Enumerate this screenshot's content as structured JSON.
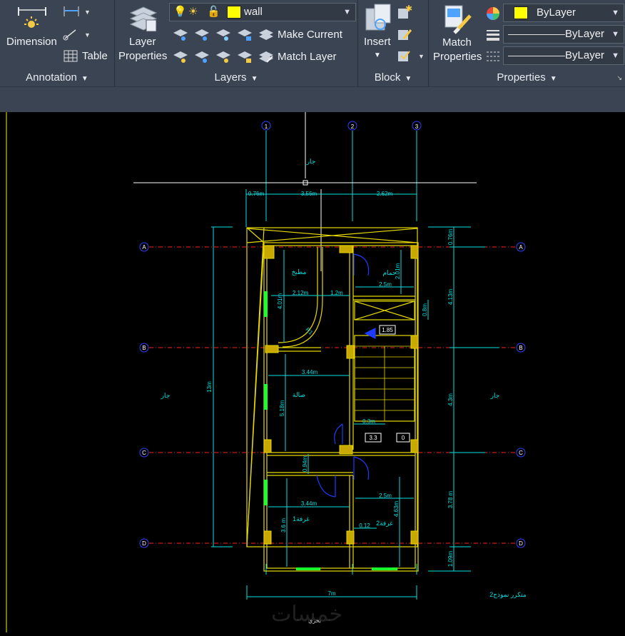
{
  "ribbon": {
    "annotation": {
      "title": "Annotation",
      "dimension_label": "Dimension",
      "table_label": "Table"
    },
    "layers": {
      "title": "Layers",
      "layer_properties_label": "Layer\nProperties",
      "layer_properties_line1": "Layer",
      "layer_properties_line2": "Properties",
      "current_layer": "wall",
      "current_layer_color": "#ffff00",
      "make_current_label": "Make Current",
      "match_layer_label": "Match Layer"
    },
    "block": {
      "title": "Block",
      "insert_label": "Insert"
    },
    "properties": {
      "title": "Properties",
      "match_line1": "Match",
      "match_line2": "Properties",
      "color_value": "ByLayer",
      "color_swatch": "#ffff00",
      "linetype_value": "ByLayer",
      "lineweight_value": "ByLayer"
    }
  },
  "drawing": {
    "grid_columns": [
      "1",
      "2",
      "3"
    ],
    "grid_rows": [
      "A",
      "B",
      "C",
      "D"
    ],
    "top_dims": [
      "0.76m",
      "3.56m",
      "2.62m"
    ],
    "neighbor_top": "جار",
    "neighbor_left": "جار",
    "neighbor_right": "جار",
    "bottom_label": "بحري",
    "total_width": "7m",
    "left_total": "13m",
    "right_dims": [
      "0.76m",
      "4.13m",
      "4.3m",
      "3.78 m",
      "1.09m"
    ],
    "rooms": {
      "kitchen": "مطبخ",
      "bath": "حمام",
      "hall": "صالة",
      "room1": "غرفة1",
      "room2": "غرفة2"
    },
    "inner_dims": {
      "kitchen_w": "2.12m",
      "corridor_w": "1.2m",
      "kitchen_h": "4.01m",
      "bath_w": "2.5m",
      "bath_h": "2.01m",
      "shaft_h": "0.8m",
      "hall_w": "3.44m",
      "hall_h": "5.18m",
      "stair_gap": "0.3m",
      "room1_w": "3.44m",
      "room1_h": "3.6 m",
      "door_gap": "0.94m",
      "room2_w": "2.5m",
      "room2_h": "4.63m",
      "wall_gap": "0.12"
    },
    "levels": {
      "top": "1.85",
      "left": "3.3",
      "right": "0"
    },
    "arc_label": "R1",
    "repeat_note": "متكرر نموذج2",
    "watermark": "خمسات"
  }
}
